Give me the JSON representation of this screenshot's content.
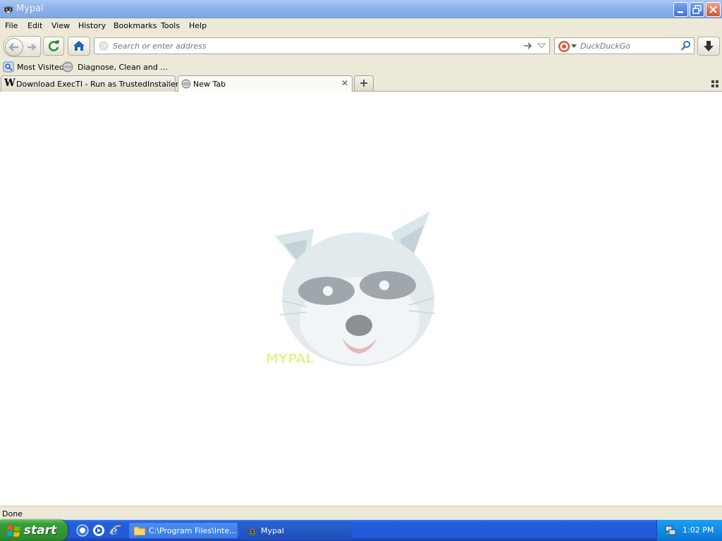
{
  "window": {
    "title": "Mypal"
  },
  "menu": [
    "File",
    "Edit",
    "View",
    "History",
    "Bookmarks",
    "Tools",
    "Help"
  ],
  "navigation": {
    "address_placeholder": "Search or enter address",
    "search_placeholder": "DuckDuckGo"
  },
  "bookmarks": [
    {
      "label": "Most Visited",
      "icon": "bookmark-folder-icon"
    },
    {
      "label": "Diagnose, Clean and ...",
      "icon": "globe-icon"
    }
  ],
  "tabs": [
    {
      "label": "Download ExecTI - Run as TrustedInstaller",
      "icon": "wikipedia-w-icon",
      "active": false
    },
    {
      "label": "New Tab",
      "icon": "globe-icon",
      "active": true
    }
  ],
  "content": {
    "logo_text": "MYPAL"
  },
  "status": {
    "text": "Done"
  },
  "taskbar": {
    "start_label": "start",
    "tasks": [
      {
        "label": "C:\\Program Files\\Inte...",
        "icon": "folder-icon"
      },
      {
        "label": "Mypal",
        "icon": "mypal-icon"
      }
    ],
    "clock": "1:02 PM"
  },
  "colors": {
    "titlebar": "#8fb3ec",
    "chrome": "#ece9d8",
    "taskbar": "#245edb",
    "start": "#3a9b3a",
    "tray": "#118be8"
  }
}
